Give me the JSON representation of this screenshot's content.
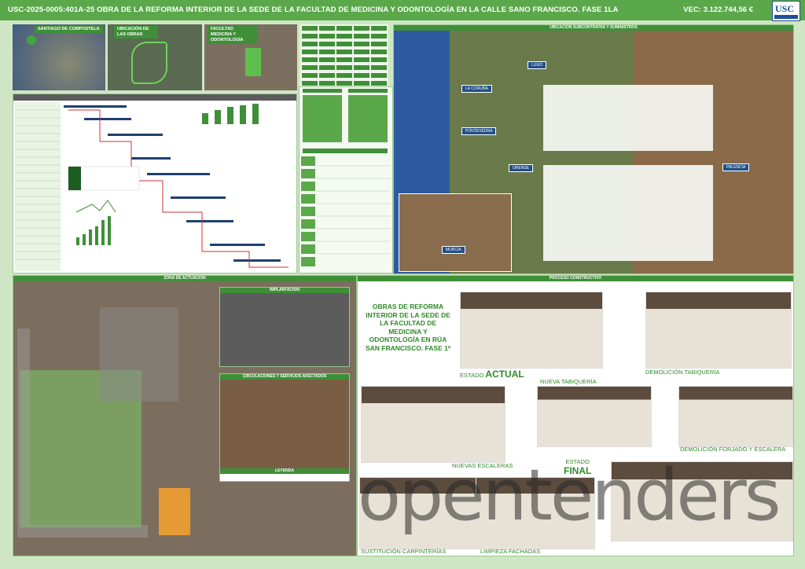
{
  "header": {
    "title": "USC-2025-0005:401A-25 OBRA DE LA REFORMA INTERIOR DE LA SEDE DE LA FACULTAD DE MEDICINA Y ODONTOLOGÍA EN LA CALLE SANO FRANCISCO. FASE 1LA",
    "budget": "VEC:  3.122.744,56 €",
    "logo": "USC"
  },
  "maps": {
    "santiago": "SANTIAGO DE COMPOSTELA",
    "ubicacion": "UBICACIÓN DE LAS OBRAS",
    "facultad": "FACULTAD MEDICINA Y ODONTOLOGÍA"
  },
  "regional": {
    "title": "UBICACIÓN SUBCONTRATAS Y SUMINISTROS",
    "provinces": [
      "LA CORUÑA",
      "LUGO",
      "PONTEVEDRA",
      "ORENSE",
      "PALENCIA",
      "MURCIA"
    ]
  },
  "zona": {
    "title": "ZONA DE ACTUACIÓN",
    "implantacion": "IMPLANTACIÓN",
    "circulaciones": "CIRCULACIONES Y SERVICIOS AFECTADOS",
    "leyenda": "LEYENDA"
  },
  "proceso": {
    "title": "PROCESO CONSTRUCTIVO",
    "project_title": "OBRAS DE REFORMA INTERIOR DE LA SEDE DE LA FACULTAD DE MEDICINA Y ODONTOLOGÍA EN RÚA SAN FRANCISCO. FASE 1ª",
    "estado": "ESTADO",
    "actual": "ACTUAL",
    "final": "FINAL",
    "steps": [
      "DEMOLICIÓN TABIQUERÍA",
      "NUEVA TABIQUERÍA",
      "DEMOLICIÓN FORJADO Y ESCALERA",
      "NUEVAS ESCALERAS",
      "SUSTITUCIÓN CARPINTERÍAS",
      "LIMPIEZA FACHADAS"
    ]
  },
  "watermark": "opentenders"
}
